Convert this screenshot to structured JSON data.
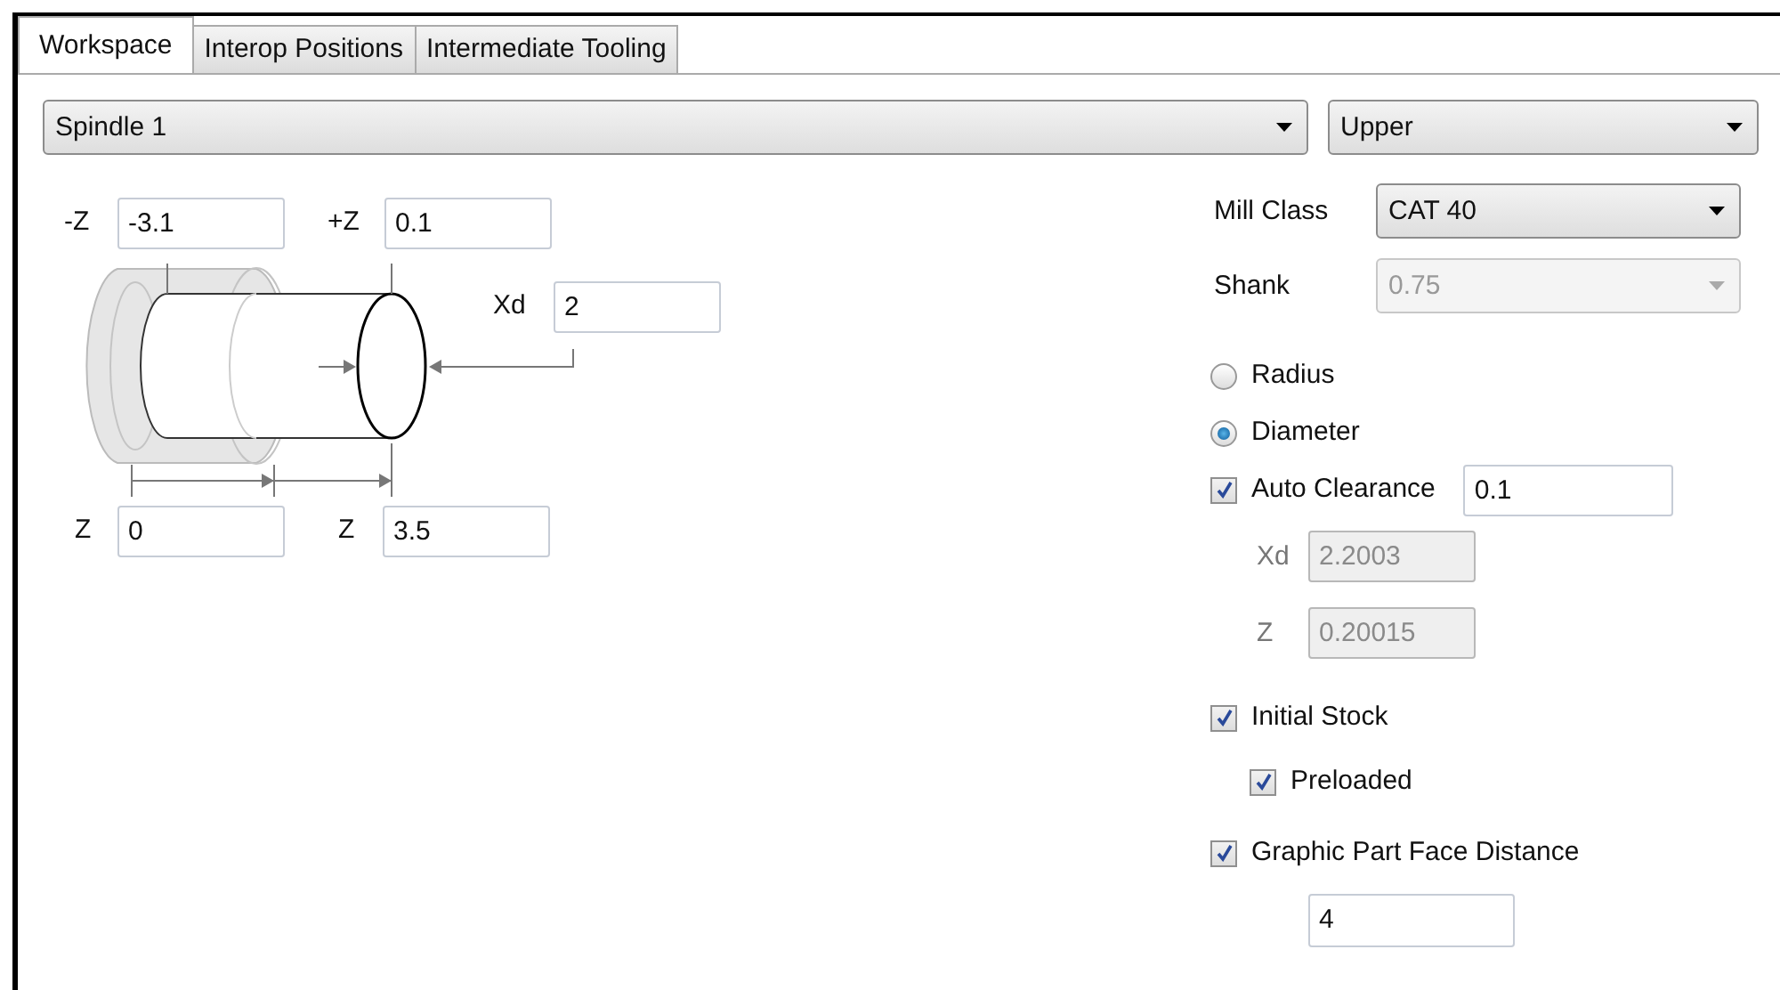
{
  "tabs": [
    {
      "label": "Workspace",
      "selected": true
    },
    {
      "label": "Interop Positions",
      "selected": false
    },
    {
      "label": "Intermediate Tooling",
      "selected": false
    }
  ],
  "spindle_select": {
    "value": "Spindle 1"
  },
  "side_select": {
    "value": "Upper"
  },
  "diagram_fields": [
    {
      "label": "-Z",
      "value": "-3.1"
    },
    {
      "label": "+Z",
      "value": "0.1"
    },
    {
      "label": "Xd",
      "value": "2"
    },
    {
      "label": "Z",
      "value": "0"
    },
    {
      "label": "Z",
      "value": "3.5"
    }
  ],
  "mill_class": {
    "label": "Mill Class",
    "value": "CAT 40",
    "disabled": false
  },
  "shank": {
    "label": "Shank",
    "value": "0.75",
    "disabled": true
  },
  "mode": [
    {
      "label": "Radius",
      "selected": false
    },
    {
      "label": "Diameter",
      "selected": true
    }
  ],
  "auto_clearance": {
    "label": "Auto Clearance",
    "checked": true,
    "value": "0.1"
  },
  "clearance_fields": [
    {
      "label": "Xd",
      "value": "2.2003",
      "disabled": true
    },
    {
      "label": "Z",
      "value": "0.20015",
      "disabled": true
    }
  ],
  "initial_stock": {
    "label": "Initial Stock",
    "checked": true
  },
  "preloaded": {
    "label": "Preloaded",
    "checked": true
  },
  "graphic_part_face_distance": {
    "label": "Graphic Part Face Distance",
    "checked": true,
    "value": "4"
  }
}
